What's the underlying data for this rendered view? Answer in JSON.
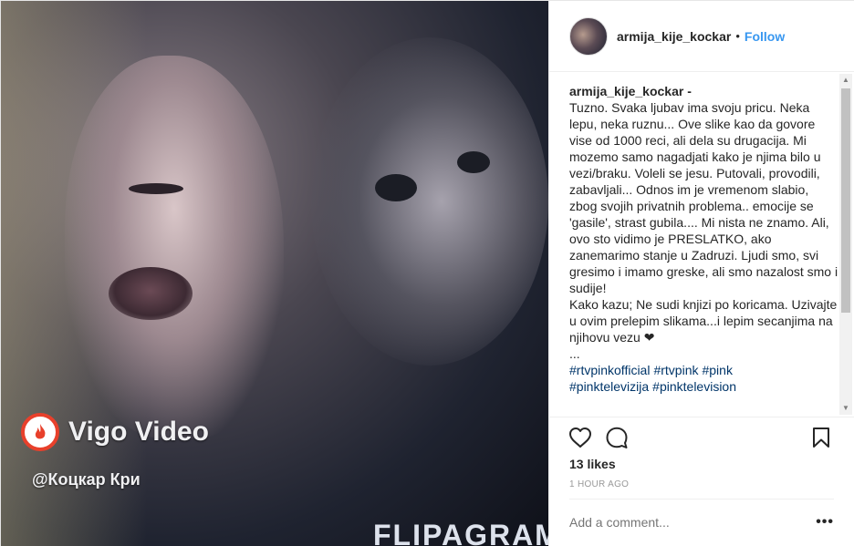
{
  "media": {
    "watermark_app": "Vigo Video",
    "watermark_user": "@Коцкар Кри",
    "watermark_flipagram": "FLIPAGRAM",
    "icon": "vigo-flame-icon"
  },
  "header": {
    "username": "armija_kije_kockar",
    "separator": "•",
    "follow_label": "Follow"
  },
  "caption": {
    "username": "armija_kije_kockar -",
    "text": "Tuzno. Svaka ljubav ima svoju pricu. Neka lepu, neka ruznu... Ove slike kao da govore vise od 1000 reci, ali dela su drugacija. Mi mozemo samo nagadjati kako je njima bilo u vezi/braku. Voleli se jesu. Putovali, provodili, zabavljali... Odnos im je vremenom slabio, zbog svojih privatnih problema.. emocije se 'gasile', strast gubila.... Mi nista ne znamo. Ali, ovo sto vidimo je PRESLATKO, ako zanemarimo stanje u Zadruzi. Ljudi smo, svi gresimo i imamo greske, ali smo nazalost smo i sudije!\nKako kazu; Ne sudi knjizi po koricama. Uzivajte u ovim prelepim slikama...i lepim secanjima na njihovu vezu ❤\n...",
    "hashtags": [
      "#rtvpinkofficial",
      "#rtvpink",
      "#pink",
      "#pinktelevizija",
      "#pinktelevision"
    ]
  },
  "actions": {
    "like_icon": "heart-icon",
    "comment_icon": "comment-icon",
    "save_icon": "bookmark-icon"
  },
  "likes": "13 likes",
  "timestamp": "1 HOUR AGO",
  "comment": {
    "placeholder": "Add a comment...",
    "more": "•••"
  },
  "colors": {
    "link": "#3897f0",
    "hashtag": "#003569",
    "text": "#262626",
    "muted": "#999999"
  }
}
